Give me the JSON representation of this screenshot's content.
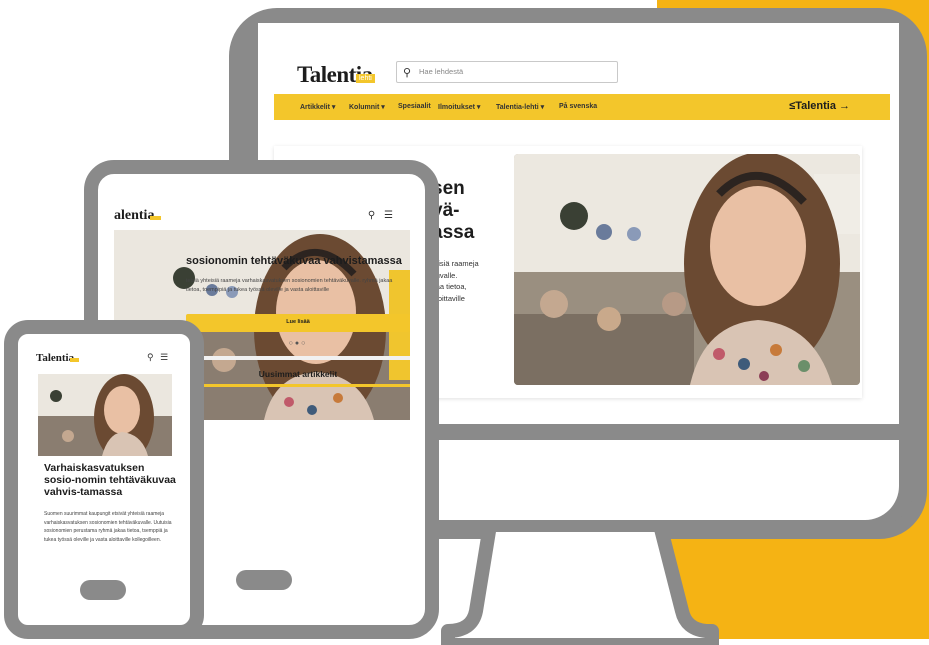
{
  "colors": {
    "accent": "#f5b314",
    "device_frame": "#8a8a8a",
    "nav_yellow": "#f3c62b",
    "text": "#1d1d1d"
  },
  "desktop": {
    "logo": "Talentia",
    "logo_tag": "lehti",
    "search_placeholder": "Hae lehdestä",
    "nav": [
      "Artikkelit ▾",
      "Kolumnit ▾",
      "Spesiaalit",
      "Ilmoitukset ▾",
      "Talentia-lehti ▾",
      "På svenska"
    ],
    "nav_brand": "≤Talentia →",
    "headline": "...ksen ...vä- ...massa",
    "headline_visible": "sen\nvä-\nassa",
    "excerpt": "teisiä raameja\nkuvalle.\nkaa tietoa,\naloittaville"
  },
  "tablet": {
    "logo": "alentia",
    "article_title": "sosionomin tehtäväkuvaa vahvistamassa",
    "article_excerpt": "teisiä yhteisiä raameja varhaiskasvatuksen sosionomien tehtäväkuvalle. ryhmä jakaa tietoa, toempipiä ja tukea työssä oleville ja vasta aloittaville",
    "button_label": "Lue lisää",
    "carousel_dots": "○●○",
    "section_title": "Uusimmat artikkelit"
  },
  "phone": {
    "logo": "Talentia",
    "article_title": "Varhaiskasvatuksen sosio-nomin tehtäväkuvaa vahvis-tamassa",
    "article_excerpt": "Suomen suurimmat kaupungit etsivät yhteisiä raameja varhaiskasvatuksen sosionomien tehtäväkuvalle. Uutuisia sosionomien perustama ryhmä jakaa tietoa, tsemppiä ja tukea työssä oleville ja vasta aloittaville kollegoilleen."
  }
}
